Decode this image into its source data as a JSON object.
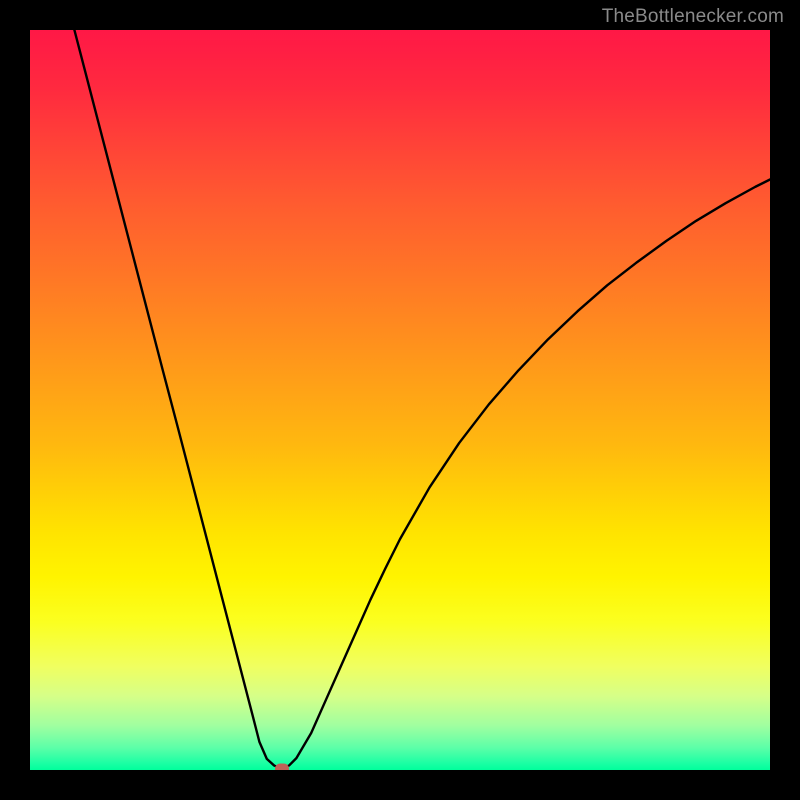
{
  "credit": "TheBottlenecker.com",
  "colors": {
    "frame": "#000000",
    "curve": "#000000",
    "dot": "#c16358"
  },
  "chart_data": {
    "type": "line",
    "title": "",
    "xlabel": "",
    "ylabel": "",
    "xlim": [
      0,
      100
    ],
    "ylim": [
      0,
      100
    ],
    "series": [
      {
        "name": "bottleneck-curve",
        "x": [
          6,
          8,
          10,
          12,
          14,
          16,
          18,
          20,
          22,
          24,
          26,
          28,
          30,
          31,
          32,
          33,
          34,
          35,
          36,
          38,
          40,
          42,
          44,
          46,
          48,
          50,
          54,
          58,
          62,
          66,
          70,
          74,
          78,
          82,
          86,
          90,
          94,
          98,
          100
        ],
        "values": [
          100,
          92.3,
          84.6,
          76.9,
          69.2,
          61.5,
          53.8,
          46.2,
          38.5,
          30.8,
          23.1,
          15.4,
          7.7,
          3.8,
          1.5,
          0.6,
          0.2,
          0.6,
          1.6,
          5.0,
          9.5,
          14.0,
          18.5,
          23.0,
          27.2,
          31.2,
          38.2,
          44.2,
          49.4,
          54.0,
          58.2,
          62.0,
          65.5,
          68.6,
          71.5,
          74.2,
          76.6,
          78.8,
          79.8
        ]
      }
    ],
    "marker": {
      "x": 34,
      "y": 0.2
    }
  }
}
